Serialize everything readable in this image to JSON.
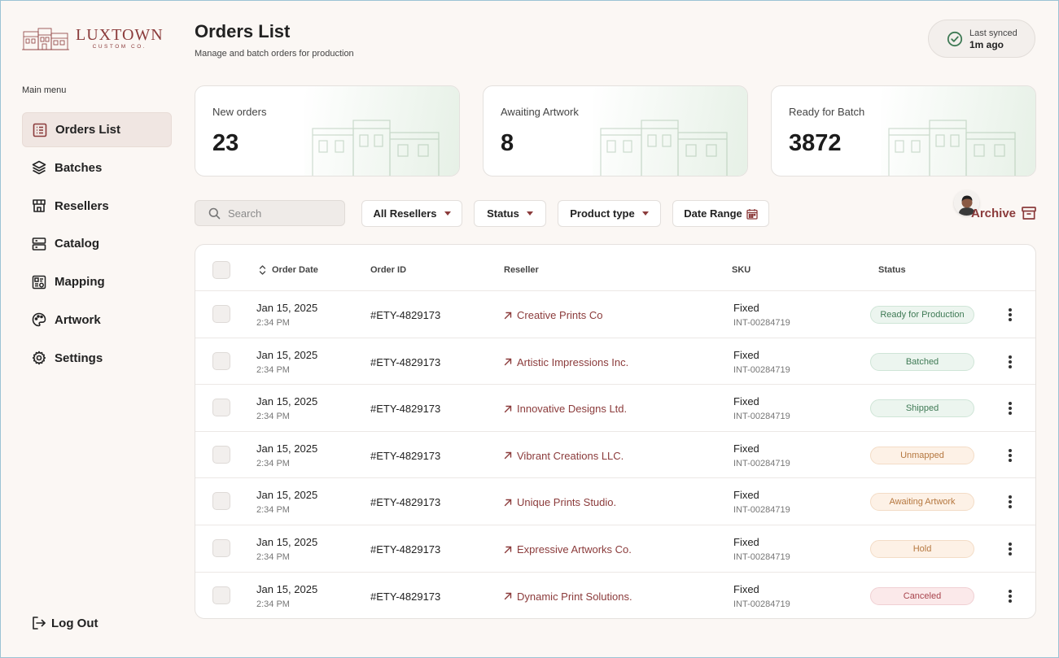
{
  "brand": {
    "name": "LUXTOWN",
    "subtitle": "CUSTOM CO."
  },
  "sidebar": {
    "menu_title": "Main menu",
    "items": [
      {
        "label": "Orders List",
        "icon": "list-icon",
        "active": true
      },
      {
        "label": "Batches",
        "icon": "layers-icon",
        "active": false
      },
      {
        "label": "Resellers",
        "icon": "store-icon",
        "active": false
      },
      {
        "label": "Catalog",
        "icon": "server-icon",
        "active": false
      },
      {
        "label": "Mapping",
        "icon": "mapping-icon",
        "active": false
      },
      {
        "label": "Artwork",
        "icon": "palette-icon",
        "active": false
      },
      {
        "label": "Settings",
        "icon": "gear-icon",
        "active": false
      }
    ],
    "logout_label": "Log Out"
  },
  "header": {
    "title": "Orders List",
    "subtitle": "Manage and batch orders for production",
    "sync_label": "Last synced",
    "sync_value": "1m ago"
  },
  "stats": [
    {
      "label": "New orders",
      "value": "23"
    },
    {
      "label": "Awaiting Artwork",
      "value": "8"
    },
    {
      "label": "Ready for Batch",
      "value": "3872"
    }
  ],
  "toolbar": {
    "search_placeholder": "Search",
    "filters": {
      "resellers": "All Resellers",
      "status": "Status",
      "product_type": "Product type",
      "date_range": "Date Range"
    },
    "archive_label": "Archive"
  },
  "table": {
    "columns": {
      "order_date": "Order Date",
      "order_id": "Order ID",
      "reseller": "Reseller",
      "sku": "SKU",
      "status": "Status"
    },
    "rows": [
      {
        "date": "Jan 15, 2025",
        "time": "2:34 PM",
        "order_id": "#ETY-4829173",
        "reseller": "Creative Prints Co",
        "sku": "Fixed",
        "sku_code": "INT-00284719",
        "status": "Ready for Production",
        "tone": "green"
      },
      {
        "date": "Jan 15, 2025",
        "time": "2:34 PM",
        "order_id": "#ETY-4829173",
        "reseller": "Artistic Impressions Inc.",
        "sku": "Fixed",
        "sku_code": "INT-00284719",
        "status": "Batched",
        "tone": "green"
      },
      {
        "date": "Jan 15, 2025",
        "time": "2:34 PM",
        "order_id": "#ETY-4829173",
        "reseller": "Innovative Designs Ltd.",
        "sku": "Fixed",
        "sku_code": "INT-00284719",
        "status": "Shipped",
        "tone": "green"
      },
      {
        "date": "Jan 15, 2025",
        "time": "2:34 PM",
        "order_id": "#ETY-4829173",
        "reseller": "Vibrant Creations LLC.",
        "sku": "Fixed",
        "sku_code": "INT-00284719",
        "status": "Unmapped",
        "tone": "orange"
      },
      {
        "date": "Jan 15, 2025",
        "time": "2:34 PM",
        "order_id": "#ETY-4829173",
        "reseller": "Unique Prints Studio.",
        "sku": "Fixed",
        "sku_code": "INT-00284719",
        "status": "Awaiting Artwork",
        "tone": "orange"
      },
      {
        "date": "Jan 15, 2025",
        "time": "2:34 PM",
        "order_id": "#ETY-4829173",
        "reseller": "Expressive Artworks Co.",
        "sku": "Fixed",
        "sku_code": "INT-00284719",
        "status": "Hold",
        "tone": "orange"
      },
      {
        "date": "Jan 15, 2025",
        "time": "2:34 PM",
        "order_id": "#ETY-4829173",
        "reseller": "Dynamic Print Solutions.",
        "sku": "Fixed",
        "sku_code": "INT-00284719",
        "status": "Canceled",
        "tone": "red"
      }
    ]
  },
  "colors": {
    "brand": "#8b3b3b",
    "background": "#fbf7f4",
    "status_green": "#3f7a55",
    "status_orange": "#b5773f",
    "status_red": "#a8444d"
  }
}
